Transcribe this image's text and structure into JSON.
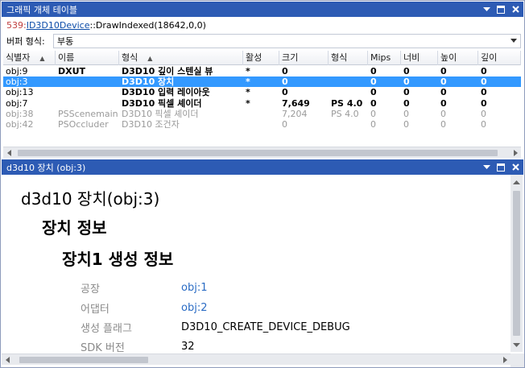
{
  "top_panel": {
    "title": "그래픽 개체 테이블",
    "call": {
      "number": "539:",
      "link": "ID3D10Device",
      "rest": "::DrawIndexed(18642,0,0)"
    },
    "buffer_format_label": "버퍼 형식:",
    "buffer_format_value": "부동"
  },
  "table": {
    "columns": [
      "식별자",
      "이름",
      "형식",
      "활성",
      "크기",
      "형식",
      "Mips",
      "너비",
      "높이",
      "깊이"
    ],
    "rows": [
      {
        "id": "obj:9",
        "name": "DXUT",
        "type": "D3D10 깊이 스텐실 뷰",
        "active": "*",
        "size": "0",
        "format": "",
        "mips": "0",
        "width": "0",
        "height": "0",
        "depth": "0",
        "state": "normal"
      },
      {
        "id": "obj:3",
        "name": "",
        "type": "D3D10 장치",
        "active": "*",
        "size": "0",
        "format": "",
        "mips": "0",
        "width": "0",
        "height": "0",
        "depth": "0",
        "state": "selected"
      },
      {
        "id": "obj:13",
        "name": "",
        "type": "D3D10 입력 레이아웃",
        "active": "*",
        "size": "0",
        "format": "",
        "mips": "0",
        "width": "0",
        "height": "0",
        "depth": "0",
        "state": "normal"
      },
      {
        "id": "obj:7",
        "name": "",
        "type": "D3D10 픽셀 셰이더",
        "active": "*",
        "size": "7,649",
        "format": "PS 4.0",
        "mips": "0",
        "width": "0",
        "height": "0",
        "depth": "0",
        "state": "normal"
      },
      {
        "id": "obj:38",
        "name": "PSScenemain",
        "type": "D3D10 픽셀 셰이더",
        "active": "",
        "size": "7,204",
        "format": "PS 4.0",
        "mips": "0",
        "width": "0",
        "height": "0",
        "depth": "0",
        "state": "dim"
      },
      {
        "id": "obj:42",
        "name": "PSOccluder",
        "type": "D3D10 조건자",
        "active": "",
        "size": "0",
        "format": "",
        "mips": "0",
        "width": "0",
        "height": "0",
        "depth": "0",
        "state": "dim"
      }
    ]
  },
  "detail_panel": {
    "title": "d3d10 장치 (obj:3)",
    "heading1": "d3d10 장치(obj:3)",
    "heading2": "장치 정보",
    "heading3": "장치1 생성 정보",
    "properties": [
      {
        "key": "공장",
        "value": "obj:1",
        "link": true
      },
      {
        "key": "어댑터",
        "value": "obj:2",
        "link": true
      },
      {
        "key": "생성 플래그",
        "value": "D3D10_CREATE_DEVICE_DEBUG",
        "link": false
      },
      {
        "key": "SDK 버전",
        "value": "32",
        "link": false
      }
    ]
  },
  "colors": {
    "titlebar": "#2d5bb4",
    "selection": "#3399ff",
    "link": "#0b4ba8",
    "call_number": "#c04040"
  },
  "icons": [
    "dropdown-icon",
    "pin-icon",
    "close-icon",
    "chevron-down-icon",
    "sort-up-icon",
    "scroll-left-icon",
    "scroll-right-icon",
    "scroll-up-icon",
    "scroll-down-icon"
  ]
}
